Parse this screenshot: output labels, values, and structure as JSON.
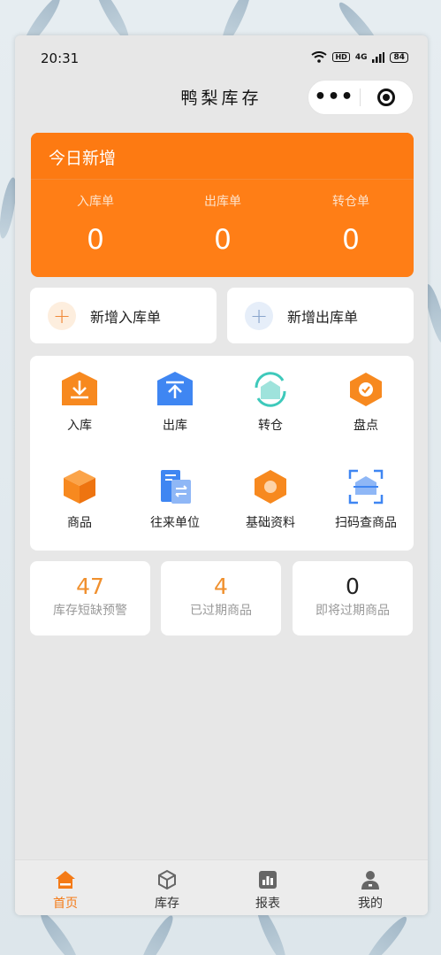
{
  "status": {
    "time": "20:31",
    "hd": "HD",
    "network": "4G",
    "battery": "84"
  },
  "nav": {
    "title": "鸭梨库存",
    "more": "•••"
  },
  "colors": {
    "accent": "#ff7e16",
    "blue": "#3f86f2",
    "teal": "#74d4cc"
  },
  "today": {
    "title": "今日新增",
    "stats": [
      {
        "label": "入库单",
        "value": "0"
      },
      {
        "label": "出库单",
        "value": "0"
      },
      {
        "label": "转仓单",
        "value": "0"
      }
    ]
  },
  "quick_actions": [
    {
      "label": "新增入库单",
      "icon": "plus-icon"
    },
    {
      "label": "新增出库单",
      "icon": "plus-icon"
    }
  ],
  "menu": [
    {
      "label": "入库",
      "icon": "inbound-icon"
    },
    {
      "label": "出库",
      "icon": "outbound-icon"
    },
    {
      "label": "转仓",
      "icon": "transfer-icon"
    },
    {
      "label": "盘点",
      "icon": "stocktake-icon"
    },
    {
      "label": "商品",
      "icon": "product-box-icon"
    },
    {
      "label": "往来单位",
      "icon": "partner-icon"
    },
    {
      "label": "基础资料",
      "icon": "basic-data-icon"
    },
    {
      "label": "扫码查商品",
      "icon": "scan-icon"
    }
  ],
  "alerts": [
    {
      "value": "47",
      "label": "库存短缺预警",
      "color": "#f0902e"
    },
    {
      "value": "4",
      "label": "已过期商品",
      "color": "#f0902e"
    },
    {
      "value": "0",
      "label": "即将过期商品",
      "color": "#222222"
    }
  ],
  "tabs": [
    {
      "label": "首页",
      "icon": "home-icon",
      "active": true
    },
    {
      "label": "库存",
      "icon": "inventory-icon",
      "active": false
    },
    {
      "label": "报表",
      "icon": "report-icon",
      "active": false
    },
    {
      "label": "我的",
      "icon": "profile-icon",
      "active": false
    }
  ]
}
